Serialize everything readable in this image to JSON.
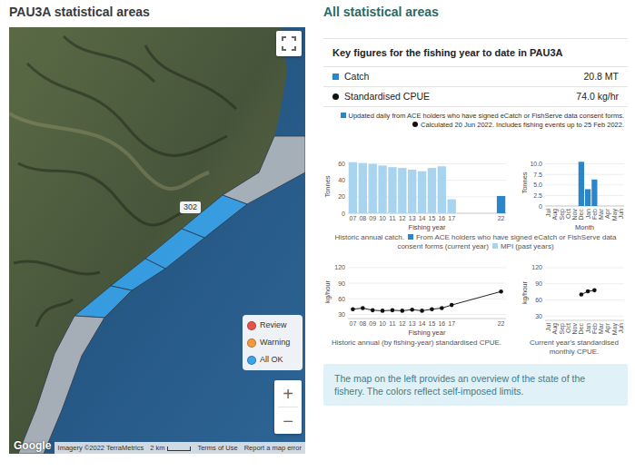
{
  "map": {
    "title": "PAU3A statistical areas",
    "area_label": "302",
    "areas": [
      {
        "color": "#b4b8bd"
      },
      {
        "color": "#3aa3ea"
      },
      {
        "color": "#3aa3ea"
      },
      {
        "color": "#3aa3ea"
      },
      {
        "color": "#3aa3ea"
      },
      {
        "color": "#b4b8bd"
      }
    ],
    "legend": [
      {
        "label": "Review",
        "color": "#e5534b"
      },
      {
        "label": "Warning",
        "color": "#f39a3d"
      },
      {
        "label": "All OK",
        "color": "#3aa3ea"
      }
    ],
    "zoom_in": "+",
    "zoom_out": "−",
    "attribution": {
      "logo": "Google",
      "imagery": "Imagery ©2022 TerraMetrics",
      "scale": "2 km",
      "terms": "Terms of Use",
      "report": "Report a map error"
    }
  },
  "summary": {
    "heading": "All statistical areas",
    "title": "Key figures for the fishing year to date in PAU3A",
    "figures": [
      {
        "kind": "square",
        "label": "Catch",
        "value": "20.8 MT",
        "color": "#2a86c8"
      },
      {
        "kind": "dot",
        "label": "Standardised CPUE",
        "value": "74.0 kg/hr",
        "color": "#111111"
      }
    ],
    "notes": [
      {
        "kind": "square",
        "text": "Updated daily from ACE holders who have signed eCatch or FishServe data consent forms.",
        "color": "#2a86c8"
      },
      {
        "kind": "dot",
        "text": "Calculated 20 Jun 2022. Includes fishing events up to 25 Feb 2022.",
        "color": "#111111"
      }
    ]
  },
  "chart_rows": [
    {
      "charts": [
        {
          "kind": "bar",
          "y_label": "Tonnes",
          "x_label": "Fishing year",
          "y_range": [
            0,
            65
          ],
          "x_range": [
            6.5,
            22.5
          ],
          "y_ticks": [
            {
              "y": 0,
              "text": "0"
            },
            {
              "y": 20,
              "text": "20"
            },
            {
              "y": 40,
              "text": "40"
            },
            {
              "y": 60,
              "text": "60"
            }
          ],
          "x_ticks": [
            {
              "x": 7,
              "text": "07"
            },
            {
              "x": 8,
              "text": "08"
            },
            {
              "x": 9,
              "text": "09"
            },
            {
              "x": 10,
              "text": "10"
            },
            {
              "x": 11,
              "text": "11"
            },
            {
              "x": 12,
              "text": "12"
            },
            {
              "x": 13,
              "text": "13"
            },
            {
              "x": 14,
              "text": "14"
            },
            {
              "x": 15,
              "text": "15"
            },
            {
              "x": 16,
              "text": "16"
            },
            {
              "x": 17,
              "text": "17"
            },
            {
              "x": 22,
              "text": "22"
            }
          ],
          "series": [
            {
              "x": 7,
              "y": 62,
              "color": "#a8d4ef"
            },
            {
              "x": 8,
              "y": 61,
              "color": "#a8d4ef"
            },
            {
              "x": 9,
              "y": 60,
              "color": "#a8d4ef"
            },
            {
              "x": 10,
              "y": 58,
              "color": "#a8d4ef"
            },
            {
              "x": 11,
              "y": 56,
              "color": "#a8d4ef"
            },
            {
              "x": 12,
              "y": 55,
              "color": "#a8d4ef"
            },
            {
              "x": 13,
              "y": 53,
              "color": "#a8d4ef"
            },
            {
              "x": 14,
              "y": 51,
              "color": "#a8d4ef"
            },
            {
              "x": 15,
              "y": 55,
              "color": "#a8d4ef"
            },
            {
              "x": 16,
              "y": 57,
              "color": "#a8d4ef"
            },
            {
              "x": 17,
              "y": 17,
              "color": "#a8d4ef"
            },
            {
              "x": 22,
              "y": 21,
              "color": "#2a86c8"
            }
          ]
        },
        {
          "kind": "bar",
          "y_label": "Tonnes",
          "x_label": "Month",
          "y_range": [
            0,
            11
          ],
          "x_range": [
            0.5,
            12.5
          ],
          "y_ticks": [
            {
              "y": 0,
              "text": "0"
            },
            {
              "y": 2.5,
              "text": "2.5"
            },
            {
              "y": 5,
              "text": "5.0"
            },
            {
              "y": 7.5,
              "text": "7.5"
            },
            {
              "y": 10,
              "text": "10.0"
            }
          ],
          "x_ticks": [
            {
              "x": 1,
              "text": "Jul"
            },
            {
              "x": 2,
              "text": "Aug"
            },
            {
              "x": 3,
              "text": "Sep"
            },
            {
              "x": 4,
              "text": "Oct"
            },
            {
              "x": 5,
              "text": "Nov"
            },
            {
              "x": 6,
              "text": "Dec"
            },
            {
              "x": 7,
              "text": "Jan"
            },
            {
              "x": 8,
              "text": "Feb"
            },
            {
              "x": 9,
              "text": "Mar"
            },
            {
              "x": 10,
              "text": "Apr"
            },
            {
              "x": 11,
              "text": "May"
            },
            {
              "x": 12,
              "text": "Jun"
            }
          ],
          "series": [
            {
              "x": 6,
              "y": 10.5,
              "color": "#2a86c8"
            },
            {
              "x": 7,
              "y": 4.0,
              "color": "#2a86c8"
            },
            {
              "x": 8,
              "y": 6.3,
              "color": "#2a86c8"
            }
          ]
        }
      ],
      "caption": {
        "lead": "Historic annual catch.",
        "legend": [
          {
            "text": "From ACE holders who have signed eCatch or FishServe data consent forms (current year)",
            "color": "#2a86c8"
          },
          {
            "text": "MPI (past years)",
            "color": "#a8d4ef"
          }
        ]
      }
    },
    {
      "charts": [
        {
          "kind": "line",
          "y_label": "kg/hour",
          "x_label": "Fishing year",
          "y_range": [
            22,
            125
          ],
          "x_range": [
            6.5,
            22.5
          ],
          "y_ticks": [
            {
              "y": 30,
              "text": "30"
            },
            {
              "y": 60,
              "text": "60"
            },
            {
              "y": 90,
              "text": "90"
            },
            {
              "y": 120,
              "text": "120"
            }
          ],
          "x_ticks": [
            {
              "x": 7,
              "text": "07"
            },
            {
              "x": 8,
              "text": "08"
            },
            {
              "x": 9,
              "text": "09"
            },
            {
              "x": 10,
              "text": "10"
            },
            {
              "x": 11,
              "text": "11"
            },
            {
              "x": 12,
              "text": "12"
            },
            {
              "x": 13,
              "text": "13"
            },
            {
              "x": 14,
              "text": "14"
            },
            {
              "x": 15,
              "text": "15"
            },
            {
              "x": 16,
              "text": "16"
            },
            {
              "x": 17,
              "text": "17"
            },
            {
              "x": 22,
              "text": "22"
            }
          ],
          "series": [
            {
              "x": 7,
              "y": 40
            },
            {
              "x": 8,
              "y": 42
            },
            {
              "x": 9,
              "y": 38
            },
            {
              "x": 10,
              "y": 37
            },
            {
              "x": 11,
              "y": 38
            },
            {
              "x": 12,
              "y": 37
            },
            {
              "x": 13,
              "y": 39
            },
            {
              "x": 14,
              "y": 37
            },
            {
              "x": 15,
              "y": 40
            },
            {
              "x": 16,
              "y": 42
            },
            {
              "x": 17,
              "y": 48
            },
            {
              "x": 22,
              "y": 74
            }
          ],
          "caption": "Historic annual (by fishing-year) standardised CPUE."
        },
        {
          "kind": "line",
          "y_label": "kg/hour",
          "x_label": "",
          "y_range": [
            22,
            125
          ],
          "x_range": [
            0.5,
            12.5
          ],
          "y_ticks": [
            {
              "y": 30,
              "text": "30"
            },
            {
              "y": 60,
              "text": "60"
            },
            {
              "y": 90,
              "text": "90"
            },
            {
              "y": 120,
              "text": "120"
            }
          ],
          "x_ticks": [
            {
              "x": 1,
              "text": "Jul"
            },
            {
              "x": 2,
              "text": "Aug"
            },
            {
              "x": 3,
              "text": "Sep"
            },
            {
              "x": 4,
              "text": "Oct"
            },
            {
              "x": 5,
              "text": "Nov"
            },
            {
              "x": 6,
              "text": "Dec"
            },
            {
              "x": 7,
              "text": "Jan"
            },
            {
              "x": 8,
              "text": "Feb"
            },
            {
              "x": 9,
              "text": "Mar"
            },
            {
              "x": 10,
              "text": "Apr"
            },
            {
              "x": 11,
              "text": "May"
            },
            {
              "x": 12,
              "text": "Jun"
            }
          ],
          "series": [
            {
              "x": 6,
              "y": 70
            },
            {
              "x": 7,
              "y": 76
            },
            {
              "x": 8,
              "y": 78
            }
          ],
          "caption": "Current year's standardised monthly CPUE."
        }
      ]
    }
  ],
  "info": "The map on the left provides an overview of the state of the fishery. The colors reflect self-imposed limits."
}
